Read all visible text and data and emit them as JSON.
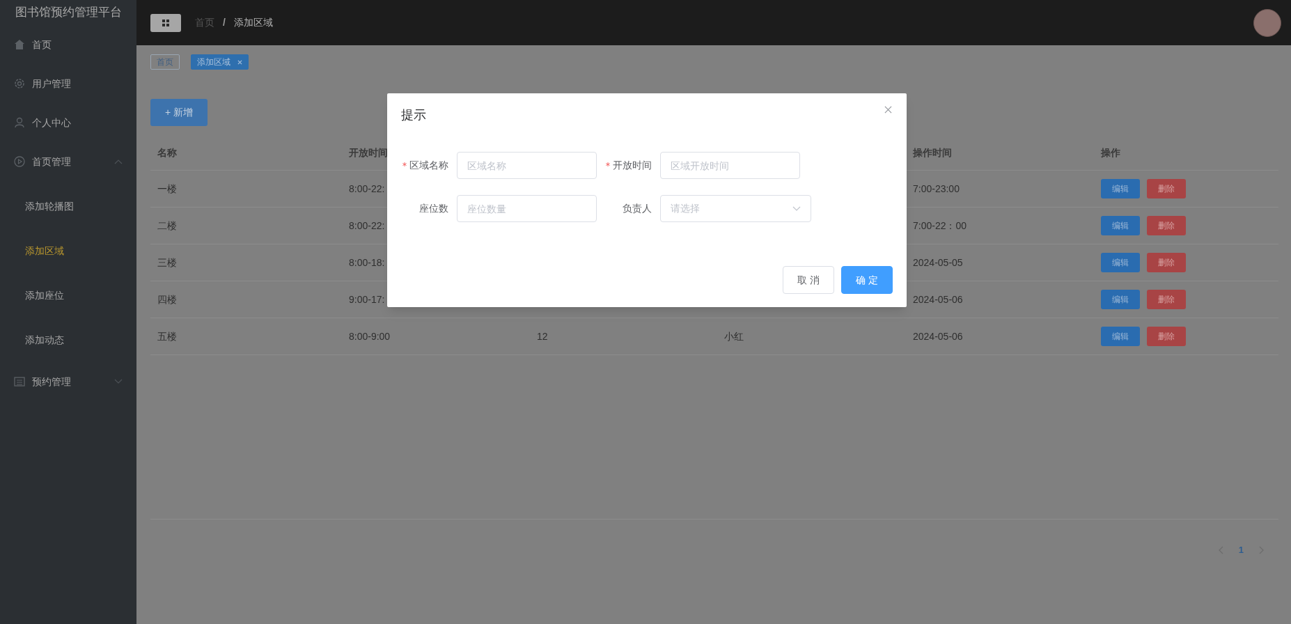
{
  "sidebar": {
    "title": "图书馆预约管理平台",
    "items": [
      {
        "label": "首页",
        "selected": false
      },
      {
        "label": "用户管理",
        "selected": false
      },
      {
        "label": "个人中心",
        "selected": false
      },
      {
        "label": "首页管理",
        "selected": false,
        "expanded": true,
        "children": [
          {
            "label": "添加轮播图",
            "selected": false
          },
          {
            "label": "添加区域",
            "selected": true
          },
          {
            "label": "添加座位",
            "selected": false
          },
          {
            "label": "添加动态",
            "selected": false
          }
        ]
      },
      {
        "label": "预约管理",
        "selected": false,
        "expanded": false
      }
    ]
  },
  "header": {
    "breadcrumb": [
      {
        "label": "首页"
      },
      {
        "label": "添加区域"
      }
    ],
    "separator": "/"
  },
  "tags": [
    {
      "label": "首页",
      "selected": false,
      "closable": false
    },
    {
      "label": "添加区域",
      "selected": true,
      "closable": true
    }
  ],
  "add_button": "+ 新增",
  "table": {
    "columns": {
      "column_1": "名称",
      "column_2": "开放时间",
      "column_5": "操作时间",
      "column_6": "操作"
    },
    "rows": [
      {
        "column_1": "一楼",
        "column_2": "8:00-22:",
        "column_5": "7:00-23:00",
        "actions": [
          "编辑",
          "删除"
        ]
      },
      {
        "column_1": "二楼",
        "column_2": "8:00-22:",
        "column_5": "7:00-22：00",
        "actions": [
          "编辑",
          "删除"
        ]
      },
      {
        "column_1": "三楼",
        "column_2": "8:00-18:",
        "column_5": "2024-05-05",
        "actions": [
          "编辑",
          "删除"
        ]
      },
      {
        "column_1": "四楼",
        "column_2": "9:00-17:",
        "column_5": "2024-05-06",
        "actions": [
          "编辑",
          "删除"
        ]
      },
      {
        "column_1": "五楼",
        "column_2": "8:00-9:00",
        "column_3": "12",
        "column_4": "小红",
        "column_5": "2024-05-06",
        "actions": [
          "编辑",
          "删除"
        ]
      }
    ]
  },
  "pagination": {
    "pages": [
      {
        "label": "1",
        "selected": true
      }
    ]
  },
  "dialog": {
    "title": "提示",
    "fields": [
      {
        "kind": "input",
        "label": "区域名称",
        "required": true,
        "placeholder": "区域名称"
      },
      {
        "kind": "input",
        "label": "开放时间",
        "required": true,
        "placeholder": "区域开放时间"
      },
      {
        "kind": "input",
        "label": "座位数",
        "required": false,
        "placeholder": "座位数量"
      },
      {
        "kind": "select",
        "label": "负责人",
        "required": false,
        "placeholder": "请选择"
      }
    ],
    "buttons": [
      {
        "kind": "default",
        "label": "取 消"
      },
      {
        "kind": "primary",
        "label": "确 定"
      }
    ]
  }
}
